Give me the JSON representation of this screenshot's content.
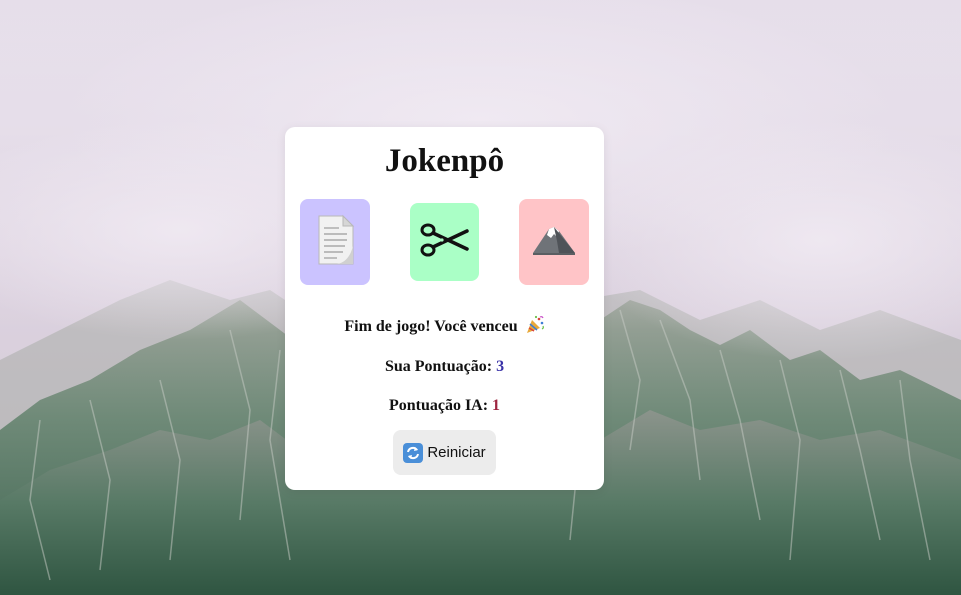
{
  "game": {
    "title": "Jokenpô",
    "result_text": "Fim de jogo! Você venceu",
    "player_score_label": "Sua Pontuação:",
    "player_score": "3",
    "ai_score_label": "Pontuação IA:",
    "ai_score": "1",
    "restart_label": "Reiniciar"
  },
  "choices": [
    {
      "name": "paper",
      "icon": "paper-icon",
      "color": "#cbc3ff"
    },
    {
      "name": "scissor",
      "icon": "scissors-icon",
      "color": "#aaffc6"
    },
    {
      "name": "rock",
      "icon": "mountain-icon",
      "color": "#ffc4c7"
    }
  ],
  "colors": {
    "player_score": "#3b33a8",
    "ai_score": "#9e2540",
    "card": "#ffffff",
    "restart_button": "#ececec"
  }
}
